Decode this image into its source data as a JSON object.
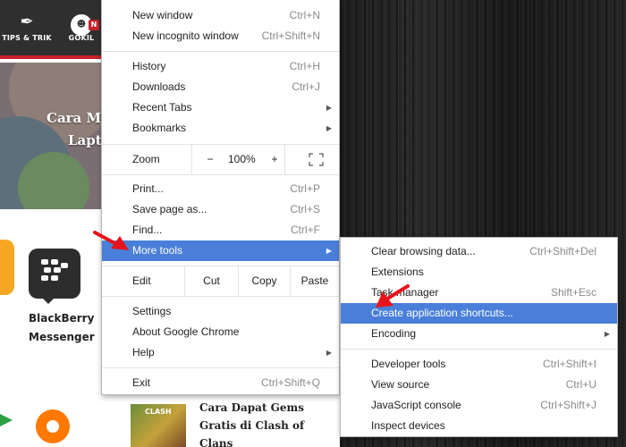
{
  "site": {
    "nav": [
      {
        "label": "TIPS & TRIK",
        "icon": "feather-icon"
      },
      {
        "label": "GOKIL",
        "icon": "gokil-logo-icon"
      }
    ],
    "hero_title_line1": "Cara Me",
    "hero_title_line2": "Lapto",
    "bbm_line1": "BlackBerry",
    "bbm_line2": "Messenger",
    "clash_thumb": "CLASH",
    "article_title": "Cara Dapat Gems Gratis di Clash of Clans"
  },
  "main_menu": {
    "new_window": {
      "label": "New window",
      "shortcut": "Ctrl+N"
    },
    "new_incognito": {
      "label": "New incognito window",
      "shortcut": "Ctrl+Shift+N"
    },
    "history": {
      "label": "History",
      "shortcut": "Ctrl+H"
    },
    "downloads": {
      "label": "Downloads",
      "shortcut": "Ctrl+J"
    },
    "recent_tabs": {
      "label": "Recent Tabs"
    },
    "bookmarks": {
      "label": "Bookmarks"
    },
    "zoom": {
      "label": "Zoom",
      "minus": "−",
      "value": "100%",
      "plus": "+"
    },
    "print": {
      "label": "Print...",
      "shortcut": "Ctrl+P"
    },
    "save_page": {
      "label": "Save page as...",
      "shortcut": "Ctrl+S"
    },
    "find": {
      "label": "Find...",
      "shortcut": "Ctrl+F"
    },
    "more_tools": {
      "label": "More tools"
    },
    "edit": {
      "label": "Edit",
      "cut": "Cut",
      "copy": "Copy",
      "paste": "Paste"
    },
    "settings": {
      "label": "Settings"
    },
    "about": {
      "label": "About Google Chrome"
    },
    "help": {
      "label": "Help"
    },
    "exit": {
      "label": "Exit",
      "shortcut": "Ctrl+Shift+Q"
    }
  },
  "sub_menu": {
    "clear_data": {
      "label": "Clear browsing data...",
      "shortcut": "Ctrl+Shift+Del"
    },
    "extensions": {
      "label": "Extensions"
    },
    "task_manager": {
      "label": "Task manager",
      "shortcut": "Shift+Esc"
    },
    "create_shortcuts": {
      "label": "Create application shortcuts..."
    },
    "encoding": {
      "label": "Encoding"
    },
    "dev_tools": {
      "label": "Developer tools",
      "shortcut": "Ctrl+Shift+I"
    },
    "view_source": {
      "label": "View source",
      "shortcut": "Ctrl+U"
    },
    "js_console": {
      "label": "JavaScript console",
      "shortcut": "Ctrl+Shift+J"
    },
    "inspect_devices": {
      "label": "Inspect devices"
    }
  },
  "colors": {
    "highlight": "#4a7fd9",
    "annotation_arrow": "#e8141c",
    "nav_bar": "#2f2f2f",
    "nav_accent": "#c8202a"
  }
}
